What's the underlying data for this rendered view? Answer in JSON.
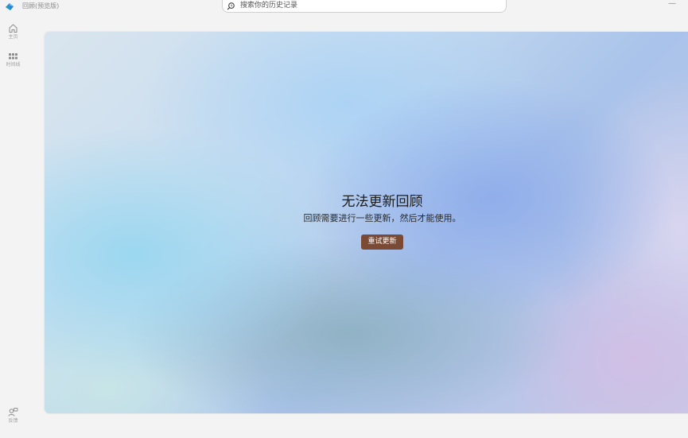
{
  "titlebar": {
    "app_title": "回顾(预览版)",
    "search_placeholder": "搜索你的历史记录",
    "minimize_glyph": "—"
  },
  "nav": {
    "items": [
      {
        "label": "主页",
        "icon": "home-icon"
      },
      {
        "label": "时间线",
        "icon": "timeline-grid-icon"
      },
      {
        "label": "反馈",
        "icon": "feedback-icon"
      }
    ]
  },
  "main": {
    "title": "无法更新回顾",
    "subtitle": "回顾需要进行一些更新，然后才能使用。",
    "retry_label": "重试更新"
  },
  "colors": {
    "accent_button": "#7a4a34",
    "window_bg": "#f3f3f3"
  }
}
